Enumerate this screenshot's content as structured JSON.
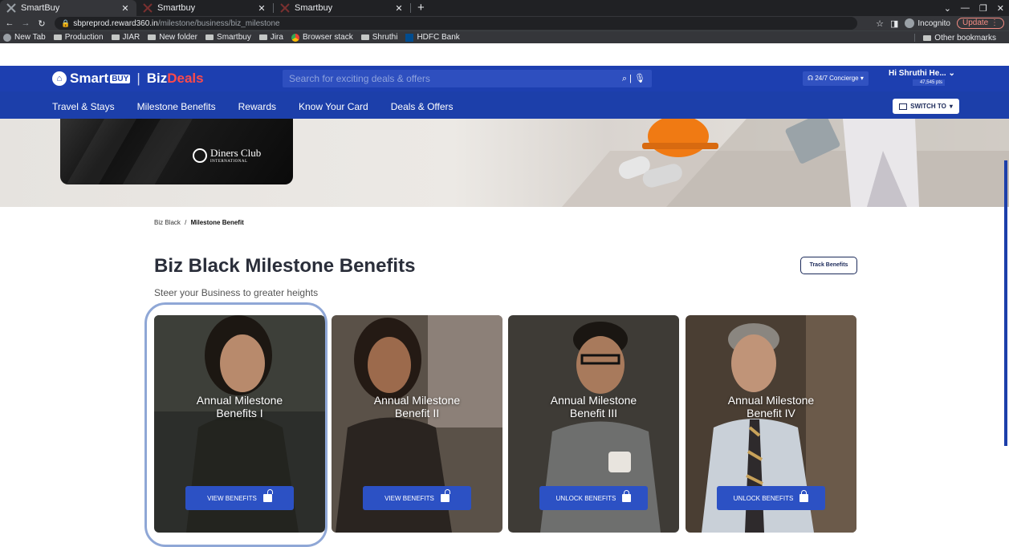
{
  "browser": {
    "tabs": [
      {
        "title": "SmartBuy",
        "active": true
      },
      {
        "title": "Smartbuy",
        "active": false
      },
      {
        "title": "Smartbuy",
        "active": false
      }
    ],
    "url_host": "sbpreprod.reward360.in",
    "url_path": "/milestone/business/biz_milestone",
    "incognito_label": "Incognito",
    "update_label": "Update",
    "bookmarks": [
      "New Tab",
      "Production",
      "JIAR",
      "New folder",
      "Smartbuy",
      "Jira",
      "Browser stack",
      "Shruthi",
      "HDFC Bank"
    ],
    "other_bookmarks": "Other bookmarks"
  },
  "header": {
    "logo_smart": "Smart",
    "logo_buy": "BUY",
    "logo_biz": "Biz",
    "logo_deals": "Deals",
    "search_placeholder": "Search for exciting deals & offers",
    "concierge": "24/7 Concierge",
    "user_greeting": "Hi Shruthi He...",
    "user_points": "47,545 pts",
    "nav": [
      "Travel & Stays",
      "Milestone Benefits",
      "Rewards",
      "Know Your Card",
      "Deals & Offers"
    ],
    "switch_label": "SWITCH TO"
  },
  "banner": {
    "card_brand": "Diners Club",
    "card_brand_sub": "INTERNATIONAL"
  },
  "breadcrumb": {
    "parent": "Biz Black",
    "separator": "/",
    "current": "Milestone Benefit"
  },
  "page": {
    "title": "Biz Black Milestone Benefits",
    "subtitle": "Steer your Business to greater heights",
    "track_button": "Track Benefits"
  },
  "cards": [
    {
      "title_line1": "Annual Milestone",
      "title_line2": "Benefits I",
      "button": "VIEW BENEFITS",
      "locked": false
    },
    {
      "title_line1": "Annual Milestone",
      "title_line2": "Benefit II",
      "button": "VIEW BENEFITS",
      "locked": false
    },
    {
      "title_line1": "Annual Milestone",
      "title_line2": "Benefit III",
      "button": "UNLOCK BENEFITS",
      "locked": true
    },
    {
      "title_line1": "Annual Milestone",
      "title_line2": "Benefit IV",
      "button": "UNLOCK BENEFITS",
      "locked": true
    }
  ],
  "colors": {
    "brand_blue": "#1d3fb0",
    "button_blue": "#2c51c4",
    "deals_red": "#ff4a4a",
    "highlight": "#8fa7d6"
  }
}
